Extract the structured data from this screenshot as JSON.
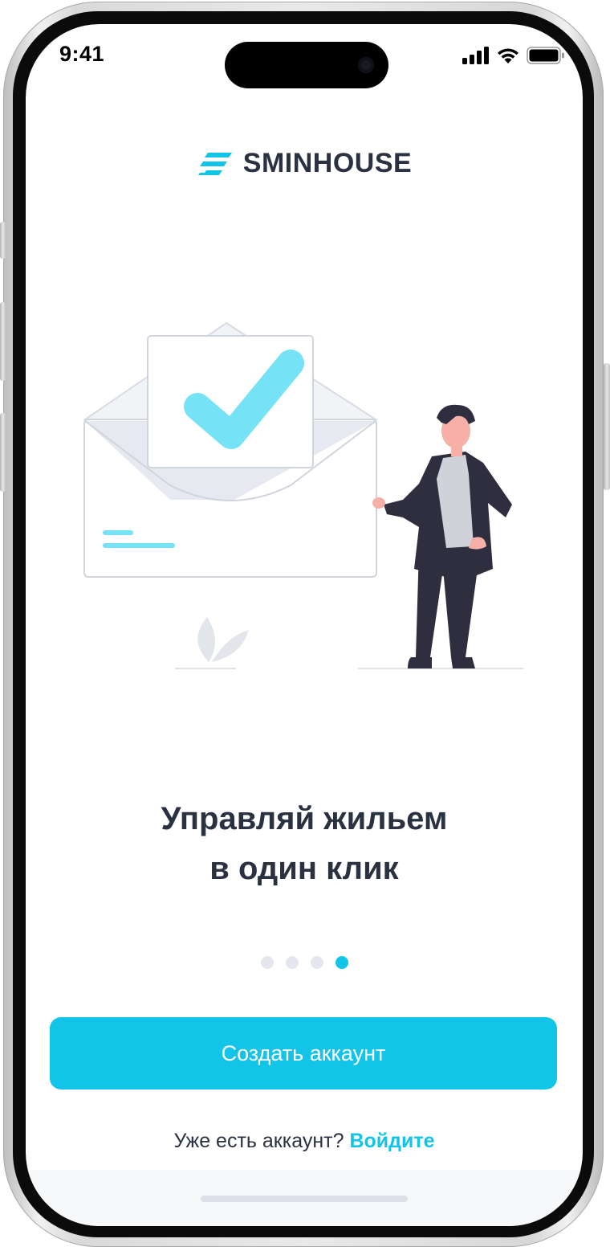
{
  "status_bar": {
    "time": "9:41",
    "signal_icon": "cellular-signal-icon",
    "wifi_icon": "wifi-icon",
    "battery_icon": "battery-icon"
  },
  "brand": {
    "name": "SMINHOUSE",
    "logo_icon": "sminhouse-logo-icon",
    "accent_color": "#12c4e7",
    "text_color": "#2a3140"
  },
  "illustration": {
    "name": "envelope-with-checkmark-and-man-illustration"
  },
  "onboarding": {
    "headline_line1": "Управляй жильем",
    "headline_line2": "в один клик",
    "pages_total": 4,
    "active_page": 4
  },
  "actions": {
    "create_account_label": "Создать аккаунт",
    "login_prompt": "Уже есть  аккаунт?",
    "login_link": "Войдите"
  }
}
